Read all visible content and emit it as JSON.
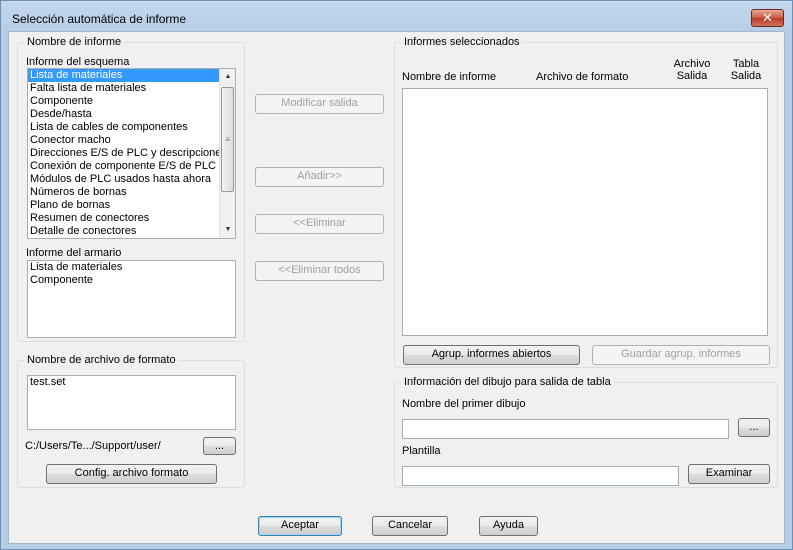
{
  "window": {
    "title": "Selección automática de informe",
    "close_label": "✕"
  },
  "left": {
    "group_title": "Nombre de informe",
    "schematic_label": "Informe del esquema",
    "schematic_items": [
      "Lista de materiales",
      "Falta lista de materiales",
      "Componente",
      "Desde/hasta",
      "Lista de cables de componentes",
      "Conector macho",
      "Direcciones E/S de PLC y descripciones",
      "Conexión de componente E/S de PLC",
      "Módulos de PLC usados hasta ahora",
      "Números de bornas",
      "Plano de bornas",
      "Resumen de conectores",
      "Detalle de conectores"
    ],
    "panel_label": "Informe del armario",
    "panel_items": [
      "Lista de materiales",
      "Componente"
    ]
  },
  "format": {
    "group_title": "Nombre de archivo de formato",
    "items": [
      "test.set"
    ],
    "path": "C:/Users/Te.../Support/user/",
    "browse_label": "...",
    "config_label": "Config. archivo formato"
  },
  "middle": {
    "modify_label": "Modificar salida",
    "add_label": "Añadir>>",
    "remove_label": "<<Eliminar",
    "remove_all_label": "<<Eliminar todos"
  },
  "selected": {
    "group_title": "Informes seleccionados",
    "col_name": "Nombre de informe",
    "col_format": "Archivo de formato",
    "col_file_1": "Archivo",
    "col_file_2": "Salida",
    "col_table_1": "Tabla",
    "col_table_2": "Salida",
    "group_open_label": "Agrup. informes abiertos",
    "save_group_label": "Guardar agrup. informes"
  },
  "drawing": {
    "group_title": "Información del dibujo para salida de tabla",
    "first_label": "Nombre del primer dibujo",
    "first_value": "",
    "browse_label": "...",
    "template_label": "Plantilla",
    "template_value": "",
    "examine_label": "Examinar"
  },
  "footer": {
    "accept": "Aceptar",
    "cancel": "Cancelar",
    "help": "Ayuda"
  }
}
